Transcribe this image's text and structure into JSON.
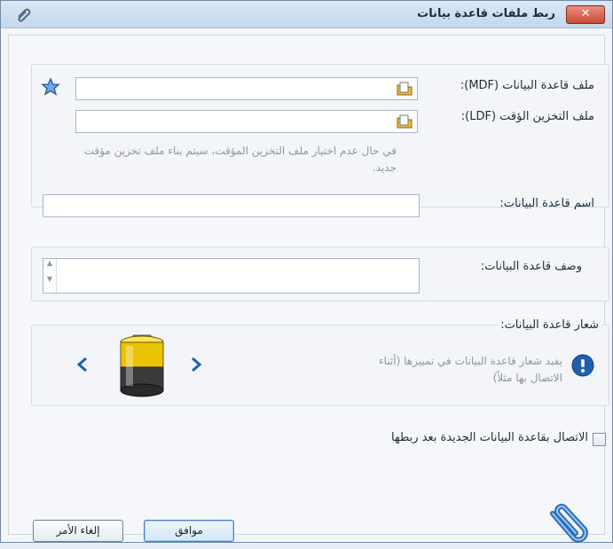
{
  "window": {
    "title": "ربط ملفات قاعدة بيانات",
    "close_label": "✕"
  },
  "form": {
    "mdf_label": "ملف قاعدة البيانات (MDF):",
    "mdf_value": "",
    "ldf_label": "ملف التخزين الؤقت (LDF):",
    "ldf_value": "",
    "ldf_hint": "في حال عدم اختيار ملف التخزين المؤقت، سيتم بناء ملف تخزين مؤقت جديد.",
    "db_name_label": "اسم قاعدة البيانات:",
    "db_name_value": "",
    "db_desc_label": "وصف قاعدة البيانات:",
    "db_desc_value": "",
    "logo_group_label": "شعار قاعدة البيانات:",
    "logo_hint": "يفيد شعار قاعدة البيانات في تمييزها (أثناء الاتصال بها مثلاً)",
    "connect_checkbox_label": "الاتصال بقاعدة البيانات الجديدة بعد ربطها",
    "connect_checked": false
  },
  "buttons": {
    "ok_label": "موافق",
    "cancel_label": "إلغاء الأمر"
  },
  "icons": {
    "mdf_star": "star-icon",
    "browse": "folder-icon",
    "info": "info-icon",
    "logo": "battery-icon",
    "prev": "chevron-left-icon",
    "next": "chevron-right-icon",
    "clip": "paperclip-icon"
  },
  "colors": {
    "accent": "#1f5fb0",
    "close": "#c94c36"
  }
}
